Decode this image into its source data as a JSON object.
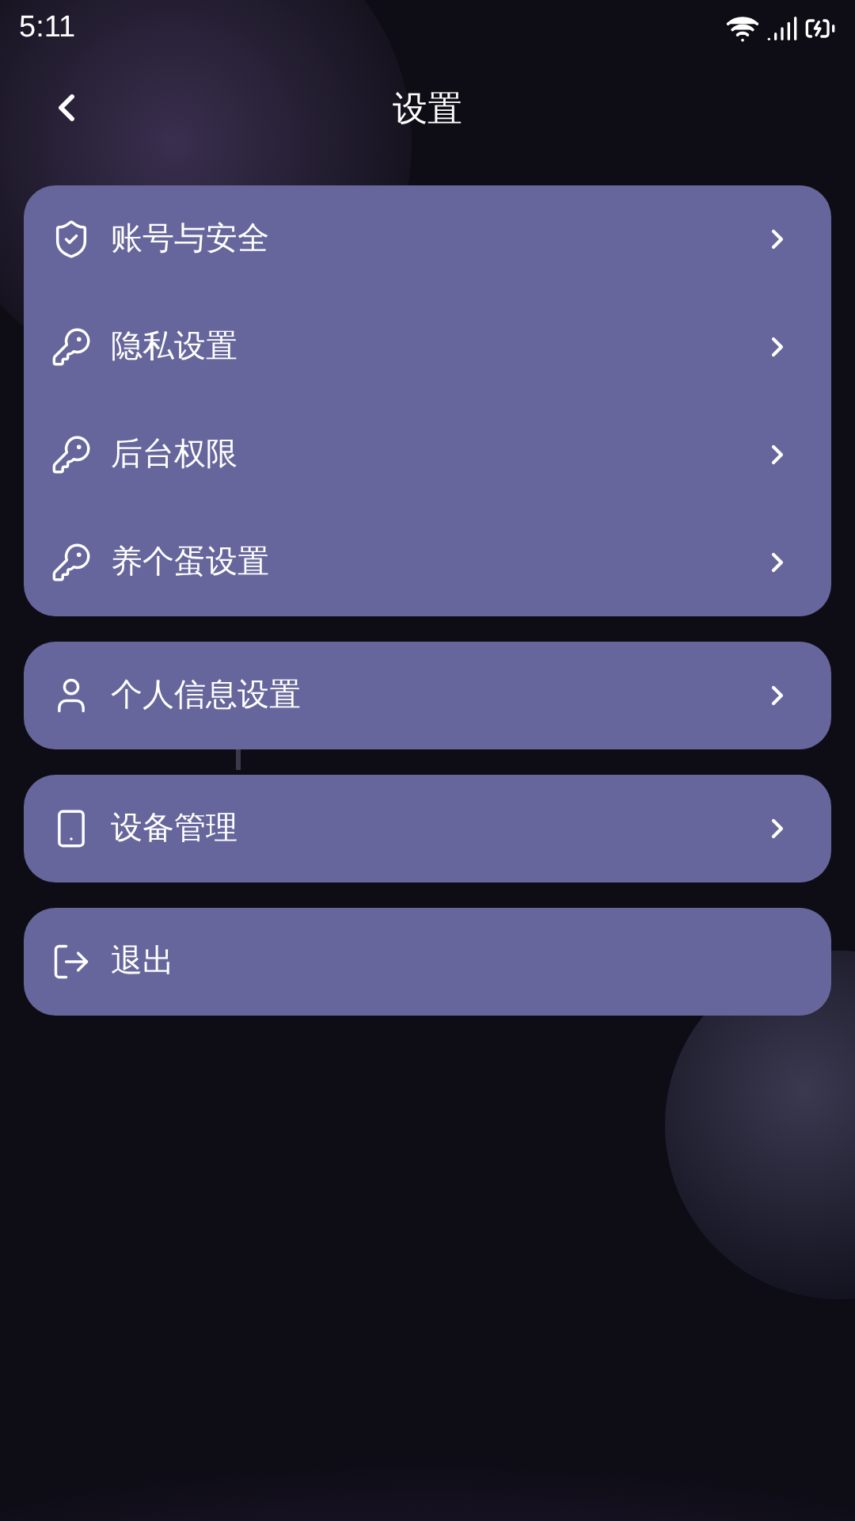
{
  "status_bar": {
    "time": "5:11"
  },
  "header": {
    "title": "设置"
  },
  "groups": [
    {
      "items": [
        {
          "label": "账号与安全",
          "kind": "shield",
          "chevron": true
        },
        {
          "label": "隐私设置",
          "kind": "key",
          "chevron": true
        },
        {
          "label": "后台权限",
          "kind": "key",
          "chevron": true
        },
        {
          "label": "养个蛋设置",
          "kind": "key",
          "chevron": true
        }
      ]
    },
    {
      "items": [
        {
          "label": "个人信息设置",
          "kind": "user",
          "chevron": true
        }
      ]
    },
    {
      "items": [
        {
          "label": "设备管理",
          "kind": "phone",
          "chevron": true
        }
      ]
    },
    {
      "items": [
        {
          "label": "退出",
          "kind": "logout",
          "chevron": false
        }
      ]
    }
  ]
}
